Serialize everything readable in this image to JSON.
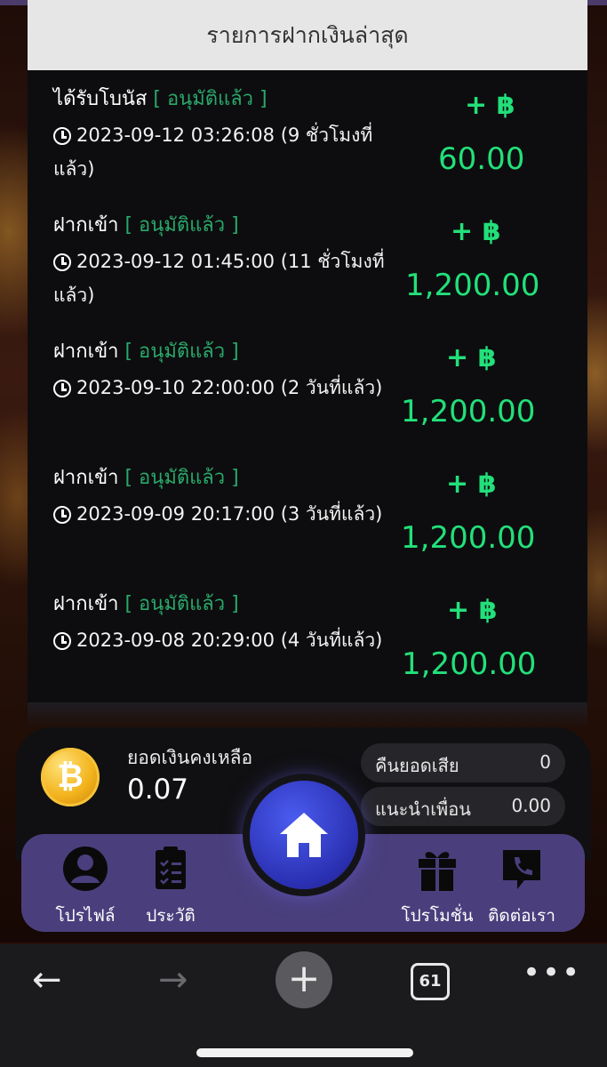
{
  "header": {
    "title": "รายการฝากเงินล่าสุด"
  },
  "transactions": [
    {
      "type": "ได้รับโบนัส",
      "status": "[ อนุมัติแล้ว ]",
      "time": "2023-09-12 03:26:08 (9 ชั่วโมงที่แล้ว)",
      "sign": "+ ฿",
      "amount": "60.00"
    },
    {
      "type": "ฝากเข้า",
      "status": "[ อนุมัติแล้ว ]",
      "time": "2023-09-12 01:45:00 (11 ชั่วโมงที่แล้ว)",
      "sign": "+ ฿",
      "amount": "1,200.00"
    },
    {
      "type": "ฝากเข้า",
      "status": "[ อนุมัติแล้ว ]",
      "time": "2023-09-10 22:00:00 (2 วันที่แล้ว)",
      "sign": "+ ฿",
      "amount": "1,200.00"
    },
    {
      "type": "ฝากเข้า",
      "status": "[ อนุมัติแล้ว ]",
      "time": "2023-09-09 20:17:00 (3 วันที่แล้ว)",
      "sign": "+ ฿",
      "amount": "1,200.00"
    },
    {
      "type": "ฝากเข้า",
      "status": "[ อนุมัติแล้ว ]",
      "time": "2023-09-08 20:29:00 (4 วันที่แล้ว)",
      "sign": "+ ฿",
      "amount": "1,200.00"
    }
  ],
  "balance": {
    "label": "ยอดเงินคงเหลือ",
    "value": "0.07",
    "coin_symbol": "₿",
    "cashback_label": "คืนยอดเสีย",
    "cashback_value": "0",
    "referral_label": "แนะนำเพื่อน",
    "referral_value": "0.00"
  },
  "nav": {
    "profile": "โปรไฟล์",
    "history": "ประวัติ",
    "promotion": "โปรโมชั่น",
    "contact": "ติดต่อเรา"
  },
  "browser": {
    "tab_count": "61"
  },
  "colors": {
    "accent_green": "#22e07a",
    "status_green": "#2aa86a",
    "nav_purple": "#4a3f7c",
    "home_blue": "#2a2fb0"
  }
}
